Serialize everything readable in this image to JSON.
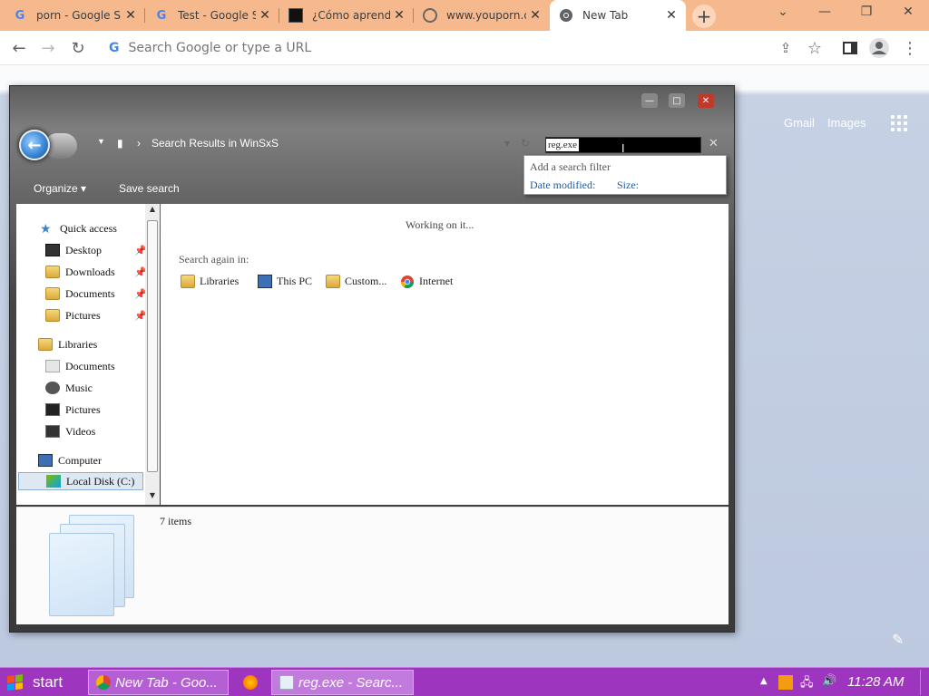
{
  "browser": {
    "tabs": [
      {
        "title": "porn - Google S",
        "favicon": "google-icon"
      },
      {
        "title": "Test - Google S",
        "favicon": "google-icon"
      },
      {
        "title": "¿Cómo aprende",
        "favicon": "site-icon"
      },
      {
        "title": "www.youporn.c",
        "favicon": "globe-icon"
      },
      {
        "title": "New Tab",
        "favicon": "chrome-icon",
        "active": true
      }
    ],
    "omnibox_placeholder": "Search Google or type a URL",
    "ntp": {
      "gmail": "Gmail",
      "images": "Images"
    },
    "colors": {
      "tabstrip": "#f6b98d",
      "ntp_bg": "#bdc9df"
    }
  },
  "explorer": {
    "breadcrumb": "Search Results in WinSxS",
    "search_query": "reg.exe",
    "filter_popup": {
      "header": "Add a search filter",
      "filters": [
        "Date modified:",
        "Size:"
      ]
    },
    "commands": {
      "organize": "Organize",
      "save_search": "Save search"
    },
    "nav": {
      "quick_access": "Quick access",
      "quick_items": [
        "Desktop",
        "Downloads",
        "Documents",
        "Pictures"
      ],
      "libraries": "Libraries",
      "library_items": [
        "Documents",
        "Music",
        "Pictures",
        "Videos"
      ],
      "computer": "Computer",
      "computer_items": [
        "Local Disk (C:)"
      ]
    },
    "content": {
      "status": "Working on it...",
      "search_again_label": "Search again in:",
      "search_again_items": [
        "Libraries",
        "This PC",
        "Custom...",
        "Internet"
      ]
    },
    "details": {
      "count": "7 items"
    }
  },
  "taskbar": {
    "start": "start",
    "buttons": [
      "New Tab - Goo...",
      "reg.exe - Searc..."
    ],
    "clock": "11:28 AM",
    "color": "#9e35bf"
  }
}
